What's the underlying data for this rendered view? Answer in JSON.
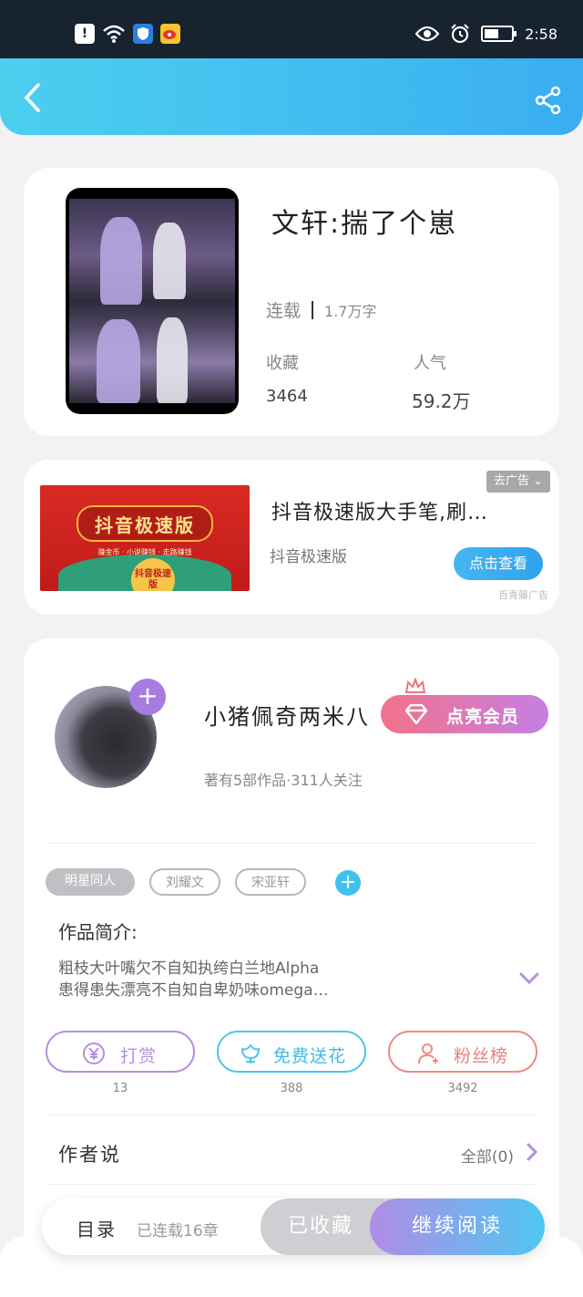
{
  "status_bar": {
    "time": "2:58",
    "battery_level": 0.6,
    "left_icons": [
      "alert-icon",
      "wifi-icon",
      "shield-app-icon",
      "weibo-icon"
    ],
    "right_icons": [
      "eye-icon",
      "alarm-icon",
      "battery-icon"
    ]
  },
  "header": {
    "back_icon": "chevron-left-icon",
    "share_icon": "share-icon",
    "gradient": [
      "#4ccfef",
      "#3aaef0"
    ]
  },
  "book": {
    "title": "文轩:揣了个崽",
    "status": "连载",
    "word_count": "1.7万字",
    "favorites_label": "收藏",
    "favorites_value": "3464",
    "popularity_label": "人气",
    "popularity_value": "59.2万"
  },
  "ad": {
    "image_banner": "抖音极速版",
    "image_tagline": "赚金币 · 小说赚钱 · 走路赚钱",
    "image_badge": "抖音极速版",
    "title": "抖音极速版大手笔,刷…",
    "brand": "抖音极速版",
    "button": "点击查看",
    "close_label": "去广告",
    "source": "百青藤广告"
  },
  "author": {
    "name": "小猪佩奇两米八",
    "vip_button": "点亮会员",
    "meta": "著有5部作品·311人关注",
    "tags": [
      "明星同人",
      "刘耀文",
      "宋亚轩"
    ],
    "intro_label": "作品简介:",
    "intro_lines": [
      "粗枝大叶嘴欠不自知执绔白兰地Alpha",
      "患得患失漂亮不自知自卑奶味omega…"
    ],
    "actions": [
      {
        "label": "打赏",
        "count": "13",
        "color": "#b68ee3",
        "icon": "yen-coin-icon"
      },
      {
        "label": "免费送花",
        "count": "388",
        "color": "#4cc6ee",
        "icon": "flower-icon"
      },
      {
        "label": "粉丝榜",
        "count": "3492",
        "color": "#ee8a86",
        "icon": "fan-user-icon"
      }
    ],
    "author_says_label": "作者说",
    "author_says_all": "全部(0)"
  },
  "bottom_bar": {
    "toc_label": "目录",
    "toc_chapter": "已连载16章",
    "collected": "已收藏",
    "continue_reading": "继续阅读"
  }
}
